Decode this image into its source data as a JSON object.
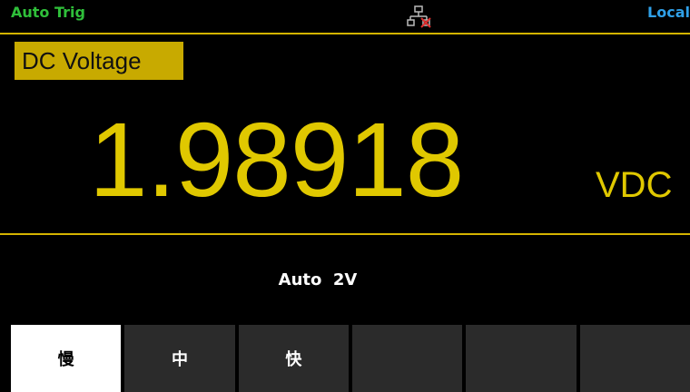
{
  "status": {
    "trigger": "Auto Trig",
    "remote": "Local",
    "network_icon": "network-disconnected-icon",
    "colors": {
      "trigger": "#2fbf3a",
      "remote": "#2fa0e8",
      "accent": "#d4b400"
    }
  },
  "measurement": {
    "function": "DC Voltage",
    "value": "1.98918",
    "unit": "VDC",
    "range": "Auto  2V"
  },
  "softkeys": [
    {
      "label": "慢",
      "selected": true
    },
    {
      "label": "中",
      "selected": false
    },
    {
      "label": "快",
      "selected": false
    },
    {
      "label": "",
      "selected": false
    },
    {
      "label": "",
      "selected": false
    },
    {
      "label": "",
      "selected": false
    }
  ]
}
